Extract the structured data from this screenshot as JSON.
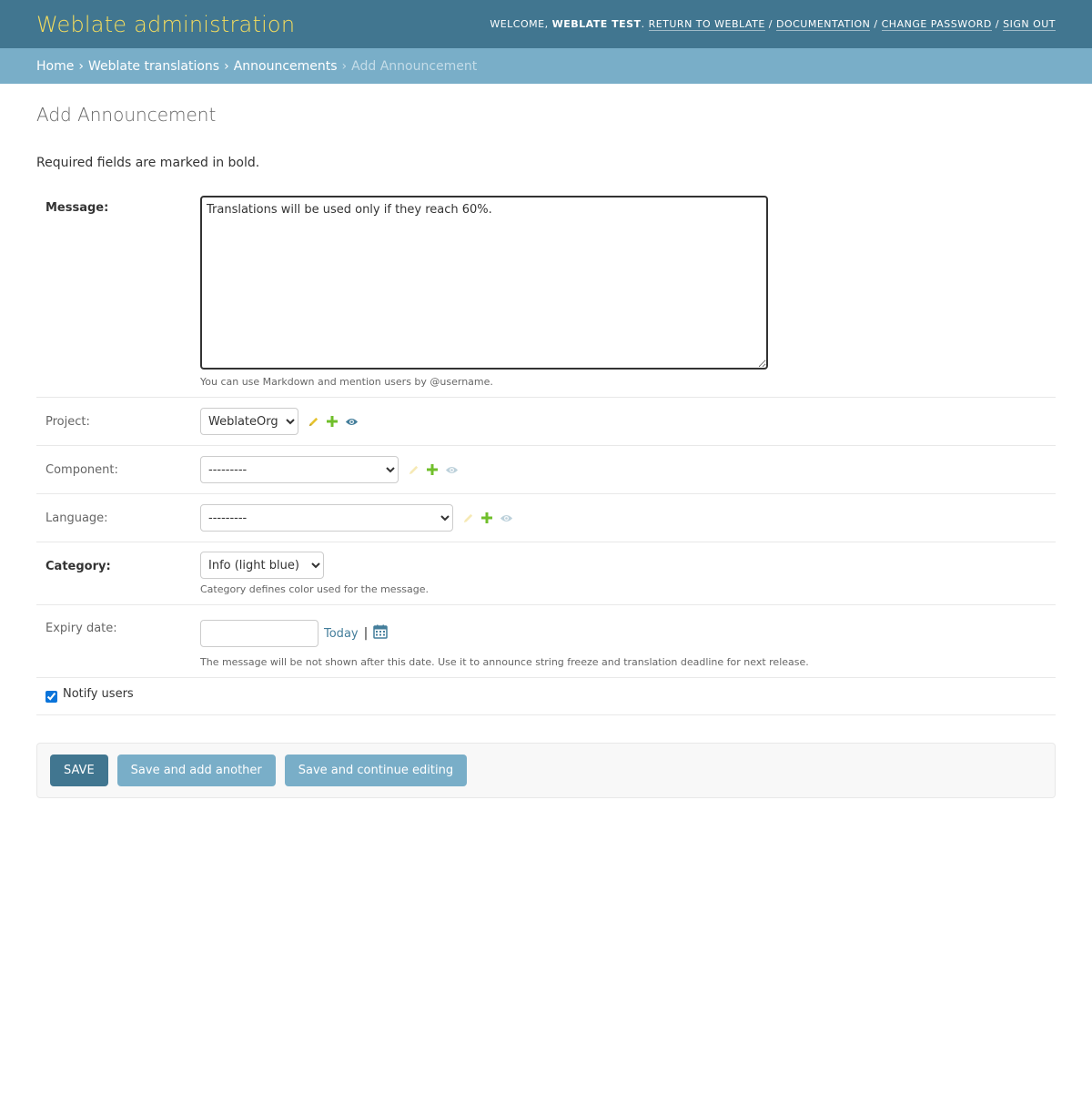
{
  "header": {
    "branding": "Weblate administration",
    "welcome": "Welcome,",
    "username": "Weblate Test",
    "links": [
      "Return to Weblate",
      "Documentation",
      "Change password",
      "Sign out"
    ]
  },
  "breadcrumbs": {
    "items": [
      "Home",
      "Weblate translations",
      "Announcements"
    ],
    "current": "Add Announcement"
  },
  "page": {
    "title": "Add Announcement",
    "note": "Required fields are marked in bold."
  },
  "form": {
    "message": {
      "label": "Message:",
      "value": "Translations will be used only if they reach 60%.",
      "help": "You can use Markdown and mention users by @username."
    },
    "project": {
      "label": "Project:",
      "selected": "WeblateOrg"
    },
    "component": {
      "label": "Component:",
      "selected": "---------"
    },
    "language": {
      "label": "Language:",
      "selected": "---------"
    },
    "category": {
      "label": "Category:",
      "selected": "Info (light blue)",
      "help": "Category defines color used for the message."
    },
    "expiry": {
      "label": "Expiry date:",
      "value": "",
      "today": "Today",
      "separator": "|",
      "help": "The message will be not shown after this date. Use it to announce string freeze and translation deadline for next release."
    },
    "notify": {
      "label": "Notify users",
      "checked": true
    }
  },
  "submit": {
    "save": "Save",
    "save_add": "Save and add another",
    "save_continue": "Save and continue editing"
  },
  "colors": {
    "header_bg": "#417690",
    "breadcrumb_bg": "#79aec8",
    "branding": "#f5dd5d",
    "edit_icon": "#e6c32f",
    "add_icon": "#70bf2b",
    "view_icon": "#447e9b"
  },
  "icons": {
    "edit": "pencil-icon",
    "add": "plus-icon",
    "view": "eye-icon",
    "calendar": "calendar-icon"
  }
}
